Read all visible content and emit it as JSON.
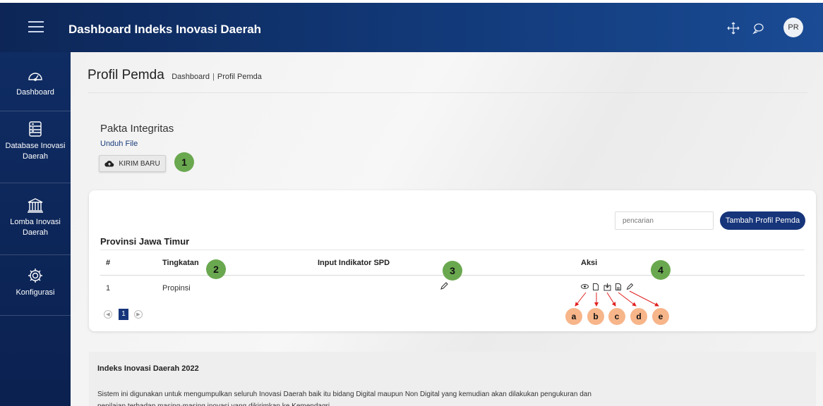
{
  "header": {
    "title": "Dashboard Indeks Inovasi Daerah",
    "avatar_initials": "PR",
    "icons": [
      "menu-icon",
      "move-icon",
      "chat-icon"
    ]
  },
  "sidebar": {
    "items": [
      {
        "label": "Dashboard",
        "icon": "speedometer-icon"
      },
      {
        "label": "Database Inovasi Daerah",
        "icon": "database-icon"
      },
      {
        "label": "Lomba Inovasi Daerah",
        "icon": "museum-icon"
      },
      {
        "label": "Konfigurasi",
        "icon": "gear-icon"
      }
    ]
  },
  "page": {
    "title": "Profil Pemda",
    "breadcrumb": [
      "Dashboard",
      "Profil Pemda"
    ]
  },
  "pakta": {
    "title": "Pakta Integritas",
    "download_link": "Unduh File",
    "send_button": "KIRIM BARU"
  },
  "table_section": {
    "search_placeholder": "pencarian",
    "add_button": "Tambah Profil Pemda",
    "province": "Provinsi Jawa Timur",
    "columns": [
      "#",
      "Tingkatan",
      "Input Indikator SPD",
      "Aksi"
    ],
    "rows": [
      {
        "no": "1",
        "tingkatan": "Propinsi"
      }
    ],
    "action_icons": [
      "eye-icon",
      "document-icon",
      "download-icon",
      "file-icon",
      "edit-icon"
    ],
    "pagination": {
      "current_page": "1"
    }
  },
  "callouts": {
    "green": [
      "1",
      "2",
      "3",
      "4"
    ],
    "orange": [
      "a",
      "b",
      "c",
      "d",
      "e"
    ]
  },
  "colors": {
    "navy": "#16357a",
    "callout_green": "#6aa84f",
    "callout_orange": "#f7b58a",
    "arrow_red": "#e02020"
  },
  "footer": {
    "title": "Indeks Inovasi Daerah 2022",
    "text_line1": "Sistem ini digunakan untuk mengumpulkan seluruh Inovasi Daerah baik itu bidang Digital maupun Non Digital yang kemudian akan dilakukan pengukuran dan",
    "text_line2": "penilaian terhadap masing-masing inovasi yang dikirimkan ke Kemendagri."
  }
}
